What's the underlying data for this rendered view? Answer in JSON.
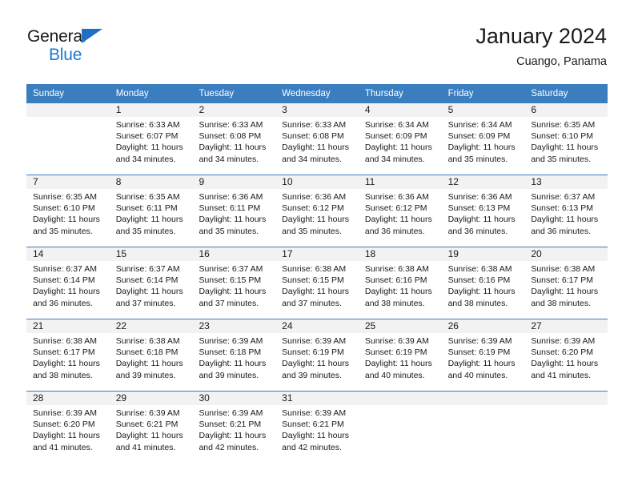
{
  "brand": {
    "name_top": "General",
    "name_bottom": "Blue",
    "triangle_color": "#1f6fc4",
    "blue_text_color": "#1a7ad4"
  },
  "header": {
    "title": "January 2024",
    "subtitle": "Cuango, Panama",
    "header_bg": "#3a7ec0",
    "header_text_color": "#ffffff",
    "daynum_bg": "#f2f2f2"
  },
  "weekdays": [
    "Sunday",
    "Monday",
    "Tuesday",
    "Wednesday",
    "Thursday",
    "Friday",
    "Saturday"
  ],
  "labels": {
    "sunrise": "Sunrise:",
    "sunset": "Sunset:",
    "daylight": "Daylight:"
  },
  "weeks": [
    [
      {
        "day": ""
      },
      {
        "day": "1",
        "sunrise": "Sunrise: 6:33 AM",
        "sunset": "Sunset: 6:07 PM",
        "daylight_l1": "Daylight: 11 hours",
        "daylight_l2": "and 34 minutes."
      },
      {
        "day": "2",
        "sunrise": "Sunrise: 6:33 AM",
        "sunset": "Sunset: 6:08 PM",
        "daylight_l1": "Daylight: 11 hours",
        "daylight_l2": "and 34 minutes."
      },
      {
        "day": "3",
        "sunrise": "Sunrise: 6:33 AM",
        "sunset": "Sunset: 6:08 PM",
        "daylight_l1": "Daylight: 11 hours",
        "daylight_l2": "and 34 minutes."
      },
      {
        "day": "4",
        "sunrise": "Sunrise: 6:34 AM",
        "sunset": "Sunset: 6:09 PM",
        "daylight_l1": "Daylight: 11 hours",
        "daylight_l2": "and 34 minutes."
      },
      {
        "day": "5",
        "sunrise": "Sunrise: 6:34 AM",
        "sunset": "Sunset: 6:09 PM",
        "daylight_l1": "Daylight: 11 hours",
        "daylight_l2": "and 35 minutes."
      },
      {
        "day": "6",
        "sunrise": "Sunrise: 6:35 AM",
        "sunset": "Sunset: 6:10 PM",
        "daylight_l1": "Daylight: 11 hours",
        "daylight_l2": "and 35 minutes."
      }
    ],
    [
      {
        "day": "7",
        "sunrise": "Sunrise: 6:35 AM",
        "sunset": "Sunset: 6:10 PM",
        "daylight_l1": "Daylight: 11 hours",
        "daylight_l2": "and 35 minutes."
      },
      {
        "day": "8",
        "sunrise": "Sunrise: 6:35 AM",
        "sunset": "Sunset: 6:11 PM",
        "daylight_l1": "Daylight: 11 hours",
        "daylight_l2": "and 35 minutes."
      },
      {
        "day": "9",
        "sunrise": "Sunrise: 6:36 AM",
        "sunset": "Sunset: 6:11 PM",
        "daylight_l1": "Daylight: 11 hours",
        "daylight_l2": "and 35 minutes."
      },
      {
        "day": "10",
        "sunrise": "Sunrise: 6:36 AM",
        "sunset": "Sunset: 6:12 PM",
        "daylight_l1": "Daylight: 11 hours",
        "daylight_l2": "and 35 minutes."
      },
      {
        "day": "11",
        "sunrise": "Sunrise: 6:36 AM",
        "sunset": "Sunset: 6:12 PM",
        "daylight_l1": "Daylight: 11 hours",
        "daylight_l2": "and 36 minutes."
      },
      {
        "day": "12",
        "sunrise": "Sunrise: 6:36 AM",
        "sunset": "Sunset: 6:13 PM",
        "daylight_l1": "Daylight: 11 hours",
        "daylight_l2": "and 36 minutes."
      },
      {
        "day": "13",
        "sunrise": "Sunrise: 6:37 AM",
        "sunset": "Sunset: 6:13 PM",
        "daylight_l1": "Daylight: 11 hours",
        "daylight_l2": "and 36 minutes."
      }
    ],
    [
      {
        "day": "14",
        "sunrise": "Sunrise: 6:37 AM",
        "sunset": "Sunset: 6:14 PM",
        "daylight_l1": "Daylight: 11 hours",
        "daylight_l2": "and 36 minutes."
      },
      {
        "day": "15",
        "sunrise": "Sunrise: 6:37 AM",
        "sunset": "Sunset: 6:14 PM",
        "daylight_l1": "Daylight: 11 hours",
        "daylight_l2": "and 37 minutes."
      },
      {
        "day": "16",
        "sunrise": "Sunrise: 6:37 AM",
        "sunset": "Sunset: 6:15 PM",
        "daylight_l1": "Daylight: 11 hours",
        "daylight_l2": "and 37 minutes."
      },
      {
        "day": "17",
        "sunrise": "Sunrise: 6:38 AM",
        "sunset": "Sunset: 6:15 PM",
        "daylight_l1": "Daylight: 11 hours",
        "daylight_l2": "and 37 minutes."
      },
      {
        "day": "18",
        "sunrise": "Sunrise: 6:38 AM",
        "sunset": "Sunset: 6:16 PM",
        "daylight_l1": "Daylight: 11 hours",
        "daylight_l2": "and 38 minutes."
      },
      {
        "day": "19",
        "sunrise": "Sunrise: 6:38 AM",
        "sunset": "Sunset: 6:16 PM",
        "daylight_l1": "Daylight: 11 hours",
        "daylight_l2": "and 38 minutes."
      },
      {
        "day": "20",
        "sunrise": "Sunrise: 6:38 AM",
        "sunset": "Sunset: 6:17 PM",
        "daylight_l1": "Daylight: 11 hours",
        "daylight_l2": "and 38 minutes."
      }
    ],
    [
      {
        "day": "21",
        "sunrise": "Sunrise: 6:38 AM",
        "sunset": "Sunset: 6:17 PM",
        "daylight_l1": "Daylight: 11 hours",
        "daylight_l2": "and 38 minutes."
      },
      {
        "day": "22",
        "sunrise": "Sunrise: 6:38 AM",
        "sunset": "Sunset: 6:18 PM",
        "daylight_l1": "Daylight: 11 hours",
        "daylight_l2": "and 39 minutes."
      },
      {
        "day": "23",
        "sunrise": "Sunrise: 6:39 AM",
        "sunset": "Sunset: 6:18 PM",
        "daylight_l1": "Daylight: 11 hours",
        "daylight_l2": "and 39 minutes."
      },
      {
        "day": "24",
        "sunrise": "Sunrise: 6:39 AM",
        "sunset": "Sunset: 6:19 PM",
        "daylight_l1": "Daylight: 11 hours",
        "daylight_l2": "and 39 minutes."
      },
      {
        "day": "25",
        "sunrise": "Sunrise: 6:39 AM",
        "sunset": "Sunset: 6:19 PM",
        "daylight_l1": "Daylight: 11 hours",
        "daylight_l2": "and 40 minutes."
      },
      {
        "day": "26",
        "sunrise": "Sunrise: 6:39 AM",
        "sunset": "Sunset: 6:19 PM",
        "daylight_l1": "Daylight: 11 hours",
        "daylight_l2": "and 40 minutes."
      },
      {
        "day": "27",
        "sunrise": "Sunrise: 6:39 AM",
        "sunset": "Sunset: 6:20 PM",
        "daylight_l1": "Daylight: 11 hours",
        "daylight_l2": "and 41 minutes."
      }
    ],
    [
      {
        "day": "28",
        "sunrise": "Sunrise: 6:39 AM",
        "sunset": "Sunset: 6:20 PM",
        "daylight_l1": "Daylight: 11 hours",
        "daylight_l2": "and 41 minutes."
      },
      {
        "day": "29",
        "sunrise": "Sunrise: 6:39 AM",
        "sunset": "Sunset: 6:21 PM",
        "daylight_l1": "Daylight: 11 hours",
        "daylight_l2": "and 41 minutes."
      },
      {
        "day": "30",
        "sunrise": "Sunrise: 6:39 AM",
        "sunset": "Sunset: 6:21 PM",
        "daylight_l1": "Daylight: 11 hours",
        "daylight_l2": "and 42 minutes."
      },
      {
        "day": "31",
        "sunrise": "Sunrise: 6:39 AM",
        "sunset": "Sunset: 6:21 PM",
        "daylight_l1": "Daylight: 11 hours",
        "daylight_l2": "and 42 minutes."
      },
      {
        "day": ""
      },
      {
        "day": ""
      },
      {
        "day": ""
      }
    ]
  ]
}
